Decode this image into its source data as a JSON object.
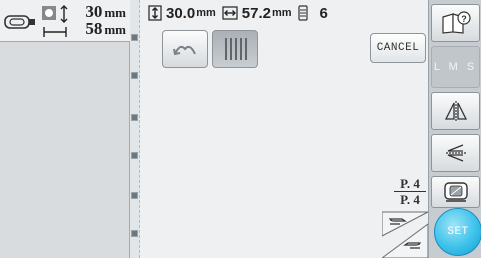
{
  "info": {
    "height_value": "30",
    "height_unit": "mm",
    "width_value": "58",
    "width_unit": "mm"
  },
  "status": {
    "height_value": "30.0",
    "height_unit": "mm",
    "width_value": "57.2",
    "width_unit": "mm",
    "color_count": "6"
  },
  "toolbar": {
    "cancel_label": "CANCEL"
  },
  "page": {
    "current": "P. 4",
    "total": "P. 4"
  },
  "sidebar": {
    "lms_label": "L M S",
    "set_label": "SET"
  },
  "colors": {
    "set_button": "#3cc2ea",
    "panel": "#d9dcdf",
    "work_area": "#eef0f2"
  },
  "icons": [
    "embroidery-frame-icon",
    "size-arrows-icon",
    "rotate-icon",
    "lines-pattern-icon",
    "help-icon",
    "mirror-icon",
    "rotate-arrows-icon",
    "density-icon",
    "page-prev-icon",
    "page-next-icon"
  ]
}
